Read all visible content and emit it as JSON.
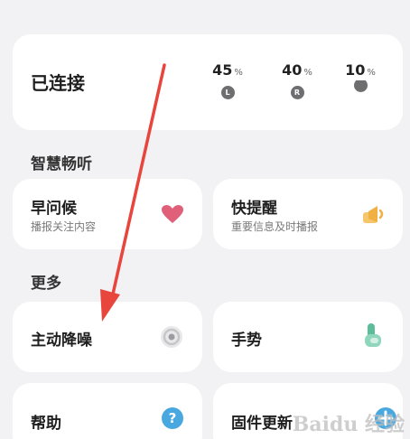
{
  "connection": {
    "status": "已连接",
    "left": {
      "value": "45",
      "unit": "%",
      "badge": "L"
    },
    "right": {
      "value": "40",
      "unit": "%",
      "badge": "R"
    },
    "case": {
      "value": "10",
      "unit": "%"
    }
  },
  "smart_listen": {
    "heading": "智慧畅听",
    "items": [
      {
        "title": "早问候",
        "subtitle": "播报关注内容",
        "icon": "heart-icon"
      },
      {
        "title": "快提醒",
        "subtitle": "重要信息及时播报",
        "icon": "speaker-bell-icon"
      }
    ]
  },
  "more": {
    "heading": "更多",
    "items": [
      {
        "title": "主动降噪",
        "icon": "noise-cancel-icon"
      },
      {
        "title": "手势",
        "icon": "gesture-icon"
      },
      {
        "title": "帮助",
        "icon": "help-icon"
      },
      {
        "title": "固件更新",
        "icon": "update-icon"
      }
    ]
  },
  "colors": {
    "heart": "#e0607a",
    "speaker": "#f0b043",
    "gesture": "#5bbd9a",
    "help": "#4aa8e0",
    "arrow": "#e8453c"
  },
  "watermark": "Baidu 经验"
}
